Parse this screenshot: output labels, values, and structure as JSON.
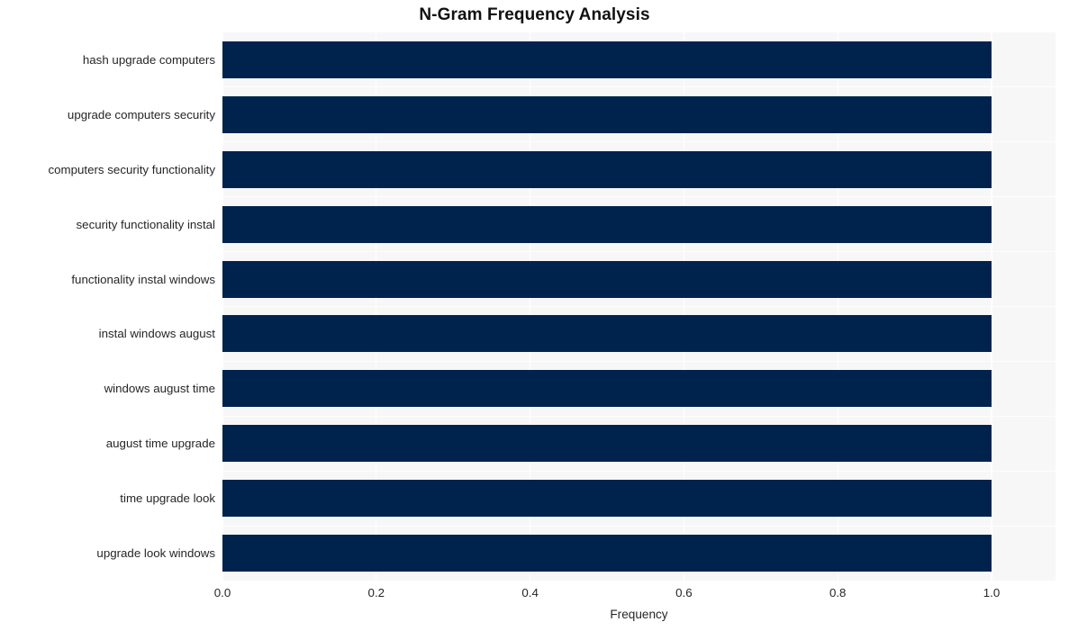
{
  "chart": {
    "title": "N-Gram Frequency Analysis",
    "xlabel": "Frequency",
    "ylabel": ""
  },
  "chart_data": {
    "type": "bar",
    "orientation": "horizontal",
    "title": "N-Gram Frequency Analysis",
    "xlabel": "Frequency",
    "ylabel": "",
    "categories": [
      "hash upgrade computers",
      "upgrade computers security",
      "computers security functionality",
      "security functionality instal",
      "functionality instal windows",
      "instal windows august",
      "windows august time",
      "august time upgrade",
      "time upgrade look",
      "upgrade look windows"
    ],
    "values": [
      1.0,
      1.0,
      1.0,
      1.0,
      1.0,
      1.0,
      1.0,
      1.0,
      1.0,
      1.0
    ],
    "xlim": [
      0.0,
      1.0831
    ],
    "xticks": [
      0.0,
      0.2,
      0.4,
      0.6,
      0.8,
      1.0
    ],
    "xtick_labels": [
      "0.0",
      "0.2",
      "0.4",
      "0.6",
      "0.8",
      "1.0"
    ],
    "bar_color": "#00234e",
    "plot_background": "#f7f7f7",
    "grid": {
      "vertical": true,
      "horizontal": true,
      "color": "#ffffff"
    },
    "legend": null
  }
}
